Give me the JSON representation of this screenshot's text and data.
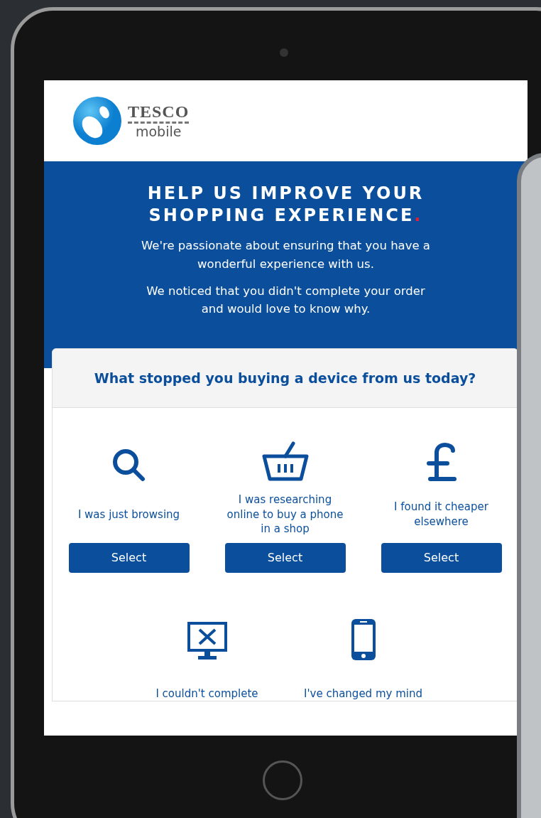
{
  "logo": {
    "brand": "TESCO",
    "sub": "mobile"
  },
  "hero": {
    "title_lines": [
      "HELP US IMPROVE YOUR",
      "SHOPPING EXPERIENCE"
    ],
    "title_mark": ".",
    "paragraphs": [
      "We're passionate about ensuring that you have a wonderful experience with us.",
      "We noticed that you didn't complete your order and would love to know why."
    ]
  },
  "question": "What stopped you buying a device from us today?",
  "options": [
    {
      "kind": "search",
      "label": "I was just browsing",
      "button": "Select"
    },
    {
      "kind": "basket",
      "label": "I  was researching online to buy a phone in a shop",
      "button": "Select"
    },
    {
      "kind": "pound",
      "label": "I found it cheaper elsewhere",
      "button": "Select"
    },
    {
      "kind": "monitor",
      "label": "I couldn't complete"
    },
    {
      "kind": "phone",
      "label": "I've changed my mind"
    }
  ]
}
